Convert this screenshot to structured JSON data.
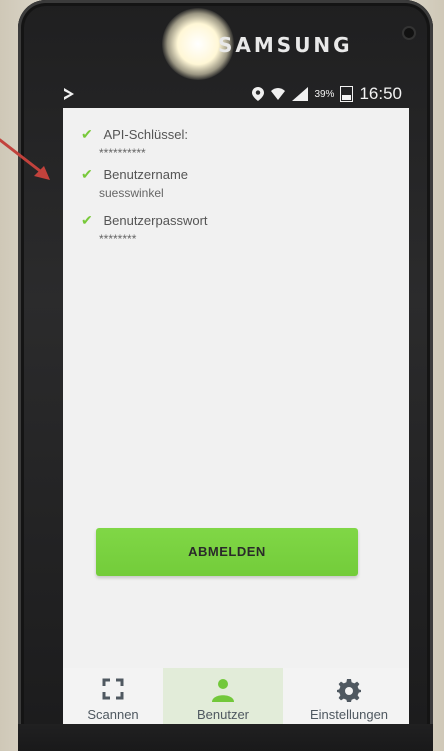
{
  "device": {
    "brand": "SAMSUNG"
  },
  "status_bar": {
    "battery_percent": "39%",
    "time": "16:50"
  },
  "credentials": {
    "items": [
      {
        "label": "API-Schlüssel:",
        "value": "**********"
      },
      {
        "label": "Benutzername",
        "value": "suesswinkel"
      },
      {
        "label": "Benutzerpasswort",
        "value": "********"
      }
    ]
  },
  "actions": {
    "logout_label": "ABMELDEN"
  },
  "bottom_nav": {
    "items": [
      {
        "label": "Scannen",
        "icon": "scan-frame-icon",
        "active": false
      },
      {
        "label": "Benutzer",
        "icon": "user-icon",
        "active": true
      },
      {
        "label": "Einstellungen",
        "icon": "gear-icon",
        "active": false
      }
    ]
  },
  "colors": {
    "accent_green": "#7ad33f",
    "active_tab_bg": "#e2ecd9",
    "annotation_arrow": "#c2423c"
  }
}
